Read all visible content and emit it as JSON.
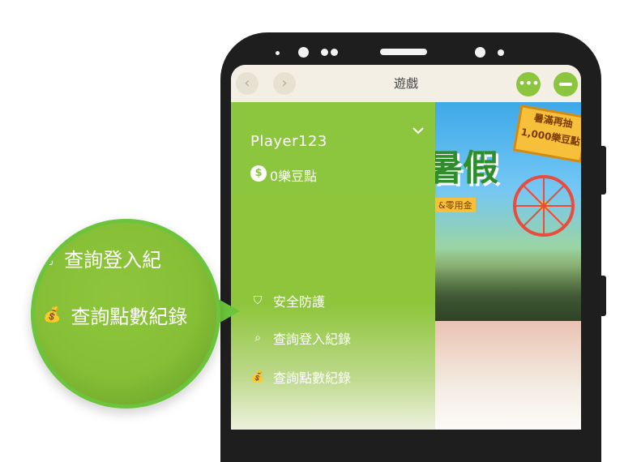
{
  "titlebar": {
    "title": "遊戲",
    "back_glyph": "‹",
    "forward_glyph": "›",
    "more_glyph": "•••"
  },
  "account": {
    "username": "Player123",
    "points": "0樂豆點",
    "coin_glyph": "$"
  },
  "menu": {
    "items": [
      {
        "label": "安全防護",
        "icon": "shield-icon",
        "glyph": "⛉"
      },
      {
        "label": "查詢登入紀錄",
        "icon": "search-icon",
        "glyph": "⌕"
      },
      {
        "label": "查詢點數紀錄",
        "icon": "money-bag-icon",
        "glyph": "💰"
      }
    ]
  },
  "magnifier": {
    "row1_label": "查詢登入紀",
    "row2_label": "查詢點數紀錄",
    "row2_glyph": "💰",
    "row1_glyph": "⌕"
  },
  "banner": {
    "sign_text": "暑滿再抽 1,000樂豆點",
    "big_text": "暑假",
    "small_text": "&零用金"
  },
  "colors": {
    "accent": "#8cc63f",
    "magnifier_border": "#6cc43c",
    "phone": "#1e1e1e"
  }
}
